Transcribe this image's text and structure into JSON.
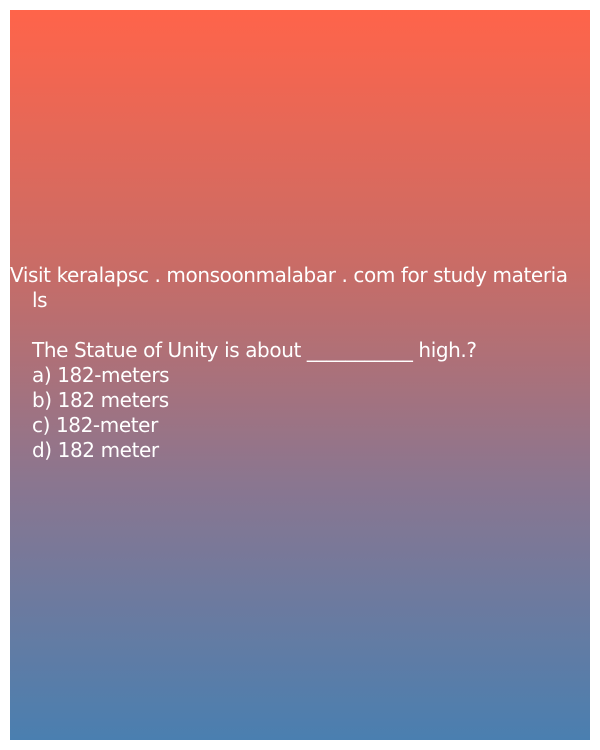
{
  "promo": {
    "line1": "Visit keralapsc . monsoonmalabar . com for study materia",
    "line2": "ls"
  },
  "question": {
    "text": "The Statue of Unity is about ___________ high.?",
    "options": [
      "a) 182-meters",
      "b) 182 meters",
      "c) 182-meter",
      "d) 182 meter"
    ]
  },
  "colors": {
    "gradient_top": "#ff644a",
    "gradient_bottom": "#4a7fb0",
    "text": "#ffffff"
  }
}
